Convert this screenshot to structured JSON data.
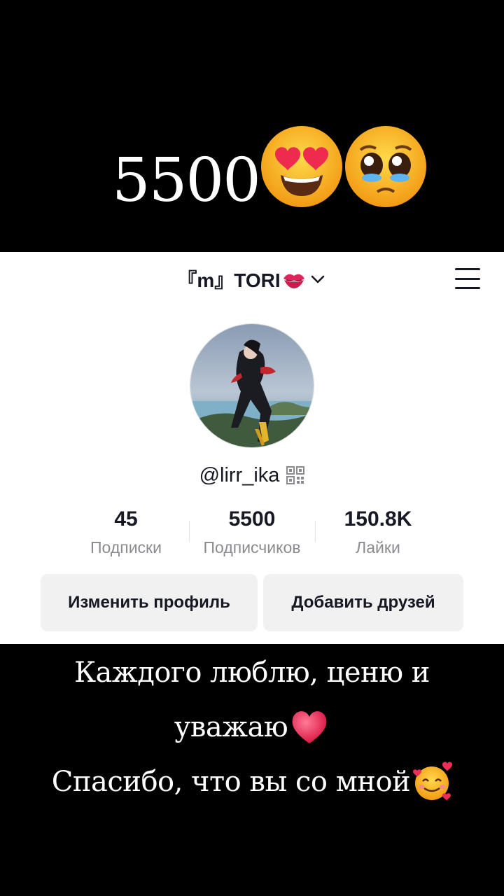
{
  "overlay": {
    "headline_number": "5500",
    "headline_emojis": [
      "heart-eyes-emoji",
      "pleading-face-emoji"
    ],
    "caption_line1": "Каждого люблю, ценю и",
    "caption_line2": "уважаю",
    "caption_line3": "Спасибо, что вы со мной",
    "caption_emojis": [
      "red-heart-emoji",
      "smiling-face-with-hearts-emoji"
    ]
  },
  "header": {
    "account_name": "『m』TORI",
    "account_emoji": "kiss-mark-icon",
    "dropdown_icon": "chevron-down-icon",
    "menu_icon": "hamburger-menu-icon"
  },
  "profile": {
    "username": "@lirr_ika",
    "qr_icon": "qr-code-icon",
    "stats": [
      {
        "value": "45",
        "label": "Подписки"
      },
      {
        "value": "5500",
        "label": "Подписчиков"
      },
      {
        "value": "150.8K",
        "label": "Лайки"
      }
    ],
    "buttons": {
      "edit_profile": "Изменить профиль",
      "add_friends": "Добавить друзей"
    }
  },
  "colors": {
    "banner_bg": "#000000",
    "card_bg": "#ffffff",
    "text_primary": "#161823",
    "text_secondary": "#8a8b91",
    "button_bg": "#f1f1f2",
    "emoji_yellow": "#fbc531",
    "heart_red": "#ef2d56"
  }
}
